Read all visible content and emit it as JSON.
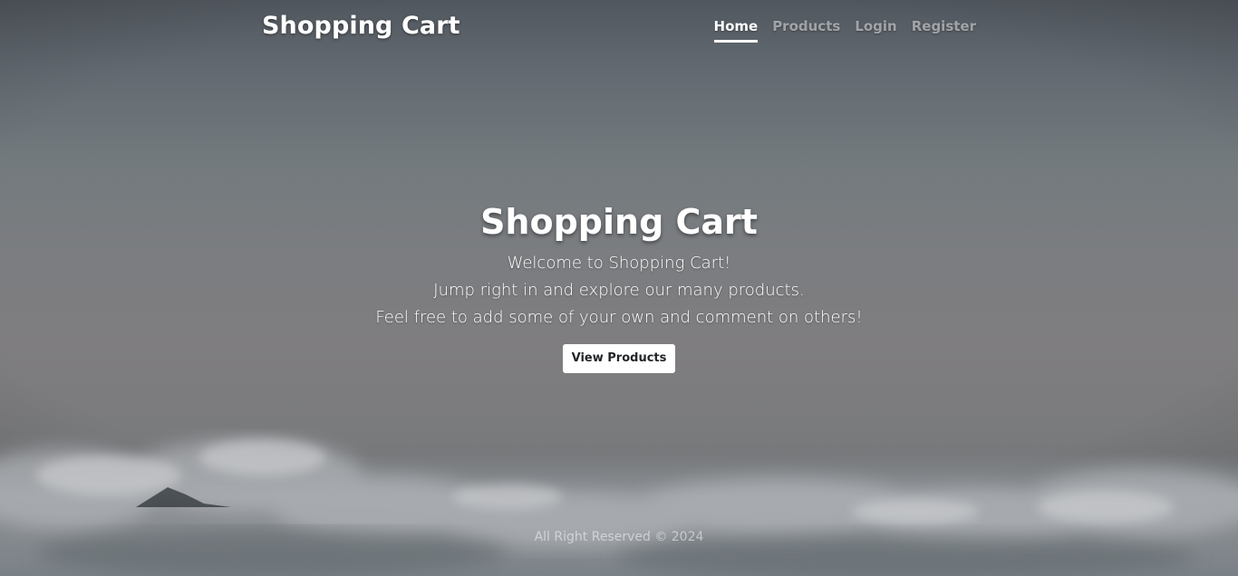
{
  "header": {
    "brand": "Shopping Cart",
    "nav": [
      {
        "label": "Home",
        "active": true
      },
      {
        "label": "Products",
        "active": false
      },
      {
        "label": "Login",
        "active": false
      },
      {
        "label": "Register",
        "active": false
      }
    ]
  },
  "hero": {
    "title": "Shopping Cart",
    "lines": [
      "Welcome to Shopping Cart!",
      "Jump right in and explore our many products.",
      "Feel free to add some of your own and comment on others!"
    ],
    "button_label": "View Products"
  },
  "footer": {
    "text": "All Right Reserved © 2024"
  },
  "colors": {
    "text": "#ffffff",
    "muted_text": "rgba(255,255,255,0.5)",
    "button_bg": "#ffffff",
    "button_text": "#212529",
    "background": "#737a7e"
  }
}
